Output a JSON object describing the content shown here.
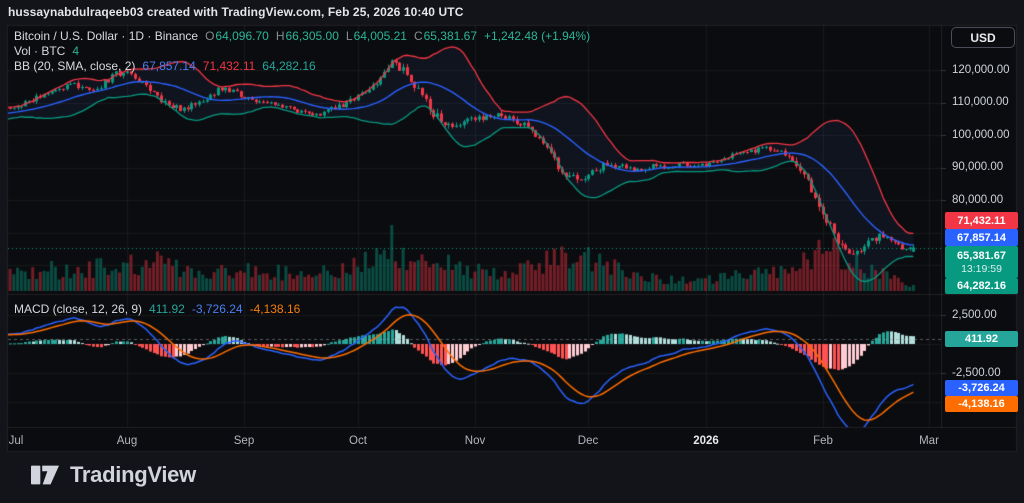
{
  "attribution": {
    "text": "hussaynabdulraqeeb03 created with TradingView.com, Feb 25, 2026 10:40 UTC"
  },
  "currency_button": {
    "label": "USD"
  },
  "symbol_legend": {
    "title": "Bitcoin / U.S. Dollar · 1D · Binance",
    "o_label": "O",
    "o_value": "64,096.70",
    "h_label": "H",
    "h_value": "66,305.00",
    "l_label": "L",
    "l_value": "64,005.21",
    "c_label": "C",
    "c_value": "65,381.67",
    "change": "+1,242.48 (+1.94%)"
  },
  "volume_legend": {
    "title": "Vol · BTC",
    "value": "4"
  },
  "bb_legend": {
    "title": "BB (20, SMA, close, 2)",
    "basis": "67,857.14",
    "upper": "71,432.11",
    "lower": "64,282.16"
  },
  "macd_legend": {
    "title": "MACD (close, 12, 26, 9)",
    "hist": "411.92",
    "macd": "-3,726.24",
    "signal": "-4,138.16"
  },
  "price_axis": {
    "labels": [
      "120,000.00",
      "110,000.00",
      "100,000.00",
      "90,000.00",
      "80,000.00"
    ]
  },
  "macd_axis": {
    "labels": [
      "2,500.00",
      "-2,500.00"
    ]
  },
  "badges": {
    "bb_upper": {
      "value": "71,432.11",
      "color": "#f23645"
    },
    "bb_basis": {
      "value": "67,857.14",
      "color": "#2962ff"
    },
    "last_price": {
      "value": "65,381.67",
      "countdown": "13:19:59",
      "color": "#089981"
    },
    "bb_lower": {
      "value": "64,282.16",
      "color": "#089981"
    },
    "macd_hist": {
      "value": "411.92",
      "color": "#26a69a"
    },
    "macd_line": {
      "value": "-3,726.24",
      "color": "#2962ff"
    },
    "macd_signal": {
      "value": "-4,138.16",
      "color": "#ff6d00"
    }
  },
  "time_axis": {
    "labels": [
      "Jul",
      "Aug",
      "Sep",
      "Oct",
      "Nov",
      "Dec",
      "2026",
      "Feb",
      "Mar"
    ]
  },
  "logo": {
    "text": "TradingView"
  },
  "chart_data": {
    "type": "candlestick",
    "title": "Bitcoin / U.S. Dollar",
    "interval": "1D",
    "exchange": "Binance",
    "last_bar": {
      "open": 64096.7,
      "high": 66305.0,
      "low": 64005.21,
      "close": 65381.67,
      "change": 1242.48,
      "change_pct": 1.94
    },
    "price_axis_ticks": [
      120000,
      110000,
      100000,
      90000,
      80000
    ],
    "price_gridlines": [
      120000,
      110000,
      100000,
      90000,
      80000,
      70000,
      60000
    ],
    "macd_axis_ticks": [
      2500,
      -2500
    ],
    "macd_gridlines": [
      2500,
      0,
      -2500,
      -5000
    ],
    "current_price_line": 65381.67,
    "bollinger": {
      "length": 20,
      "mult": 2,
      "basis_last": 67857.14,
      "upper_last": 71432.11,
      "lower_last": 64282.16
    },
    "macd": {
      "fast": 12,
      "slow": 26,
      "smoothing": 9,
      "macd_last": -3726.24,
      "signal_last": -4138.16,
      "hist_last": 411.92
    },
    "month_start_days": [
      0,
      31,
      62,
      92,
      123,
      153,
      184,
      215,
      243
    ],
    "num_days": 240,
    "pre_days": 30,
    "seed": 11,
    "price_anchors": [
      [
        -30,
        103500
      ],
      [
        -20,
        105500
      ],
      [
        -10,
        106500
      ],
      [
        0,
        108200
      ],
      [
        6,
        111000
      ],
      [
        12,
        114200
      ],
      [
        17,
        115600
      ],
      [
        22,
        113200
      ],
      [
        28,
        118800
      ],
      [
        31,
        119600
      ],
      [
        34,
        116800
      ],
      [
        40,
        110800
      ],
      [
        46,
        107600
      ],
      [
        52,
        111500
      ],
      [
        56,
        114600
      ],
      [
        62,
        112100
      ],
      [
        68,
        109600
      ],
      [
        75,
        107800
      ],
      [
        81,
        106300
      ],
      [
        88,
        109200
      ],
      [
        94,
        112800
      ],
      [
        97,
        116500
      ],
      [
        101,
        122800
      ],
      [
        104,
        119800
      ],
      [
        108,
        113500
      ],
      [
        112,
        106800
      ],
      [
        116,
        103200
      ],
      [
        120,
        104200
      ],
      [
        124,
        105400
      ],
      [
        128,
        106400
      ],
      [
        133,
        104600
      ],
      [
        138,
        101800
      ],
      [
        142,
        95500
      ],
      [
        146,
        88500
      ],
      [
        150,
        85800
      ],
      [
        153,
        88000
      ],
      [
        157,
        90500
      ],
      [
        162,
        90800
      ],
      [
        166,
        89200
      ],
      [
        170,
        90400
      ],
      [
        174,
        89600
      ],
      [
        178,
        91200
      ],
      [
        182,
        90200
      ],
      [
        186,
        91800
      ],
      [
        191,
        93600
      ],
      [
        196,
        94800
      ],
      [
        200,
        96200
      ],
      [
        204,
        94400
      ],
      [
        208,
        90800
      ],
      [
        211,
        86400
      ],
      [
        213,
        80500
      ],
      [
        216,
        73500
      ],
      [
        219,
        68000
      ],
      [
        221,
        64800
      ],
      [
        224,
        63900
      ],
      [
        227,
        66500
      ],
      [
        230,
        68800
      ],
      [
        233,
        67200
      ],
      [
        236,
        64900
      ],
      [
        239,
        65381.67
      ]
    ],
    "volatility_anchors": [
      [
        -30,
        1500
      ],
      [
        0,
        1700
      ],
      [
        20,
        1900
      ],
      [
        28,
        2100
      ],
      [
        40,
        2300
      ],
      [
        60,
        1800
      ],
      [
        80,
        1600
      ],
      [
        95,
        2200
      ],
      [
        101,
        2600
      ],
      [
        106,
        2800
      ],
      [
        112,
        3400
      ],
      [
        120,
        2400
      ],
      [
        135,
        2000
      ],
      [
        146,
        2800
      ],
      [
        155,
        2400
      ],
      [
        165,
        1500
      ],
      [
        180,
        1200
      ],
      [
        195,
        1600
      ],
      [
        205,
        2000
      ],
      [
        212,
        3200
      ],
      [
        218,
        3600
      ],
      [
        224,
        2800
      ],
      [
        230,
        2200
      ],
      [
        239,
        1700
      ]
    ],
    "volume_anchors": [
      [
        -30,
        0.25
      ],
      [
        0,
        0.28
      ],
      [
        10,
        0.32
      ],
      [
        20,
        0.3
      ],
      [
        28,
        0.42
      ],
      [
        34,
        0.38
      ],
      [
        40,
        0.45
      ],
      [
        50,
        0.3
      ],
      [
        60,
        0.32
      ],
      [
        70,
        0.28
      ],
      [
        80,
        0.3
      ],
      [
        90,
        0.38
      ],
      [
        97,
        0.48
      ],
      [
        101,
        1.0
      ],
      [
        103,
        0.62
      ],
      [
        107,
        0.45
      ],
      [
        112,
        0.5
      ],
      [
        118,
        0.38
      ],
      [
        124,
        0.32
      ],
      [
        130,
        0.3
      ],
      [
        138,
        0.36
      ],
      [
        144,
        0.48
      ],
      [
        150,
        0.52
      ],
      [
        156,
        0.4
      ],
      [
        162,
        0.3
      ],
      [
        168,
        0.22
      ],
      [
        174,
        0.18
      ],
      [
        180,
        0.14
      ],
      [
        186,
        0.18
      ],
      [
        192,
        0.22
      ],
      [
        198,
        0.26
      ],
      [
        204,
        0.3
      ],
      [
        209,
        0.42
      ],
      [
        213,
        0.55
      ],
      [
        217,
        0.6
      ],
      [
        221,
        0.5
      ],
      [
        225,
        0.38
      ],
      [
        228,
        0.3
      ],
      [
        231,
        0.26
      ],
      [
        234,
        0.18
      ],
      [
        237,
        0.12
      ],
      [
        239,
        0.1
      ]
    ],
    "colors": {
      "up": "#089981",
      "down": "#f23645",
      "bb_basis": "#2962ff",
      "bb_upper": "#f23645",
      "bb_lower": "#089981",
      "bb_fill": "rgba(90,130,255,0.07)",
      "vol_up": "rgba(8,153,129,0.45)",
      "vol_down": "rgba(242,54,69,0.45)",
      "macd_line": "#2962ff",
      "signal_line": "#ff6d00",
      "hist_grow_above": "#26a69a",
      "hist_fall_above": "#b2dfdb",
      "hist_grow_below": "#ff5252",
      "hist_fall_below": "#ffcdd2",
      "grid": "rgba(255,255,255,0.05)",
      "border": "rgba(255,255,255,0.09)",
      "price_line": "#089981",
      "last_value_dash": "rgba(150,156,166,0.55)"
    }
  }
}
